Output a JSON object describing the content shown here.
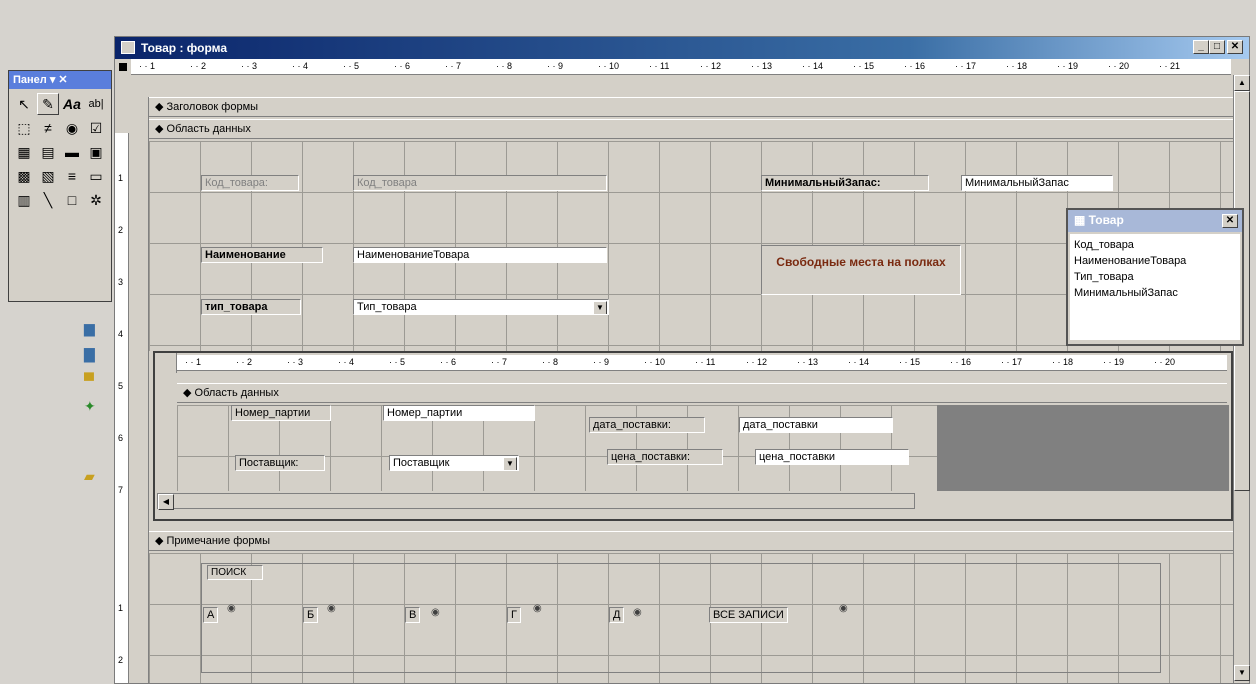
{
  "window": {
    "title": "Товар : форма"
  },
  "toolbox": {
    "title": "Панел ▾ ✕"
  },
  "ruler_numbers": [
    "1",
    "2",
    "3",
    "4",
    "5",
    "6",
    "7",
    "8",
    "9",
    "10",
    "11",
    "12",
    "13",
    "14",
    "15",
    "16",
    "17",
    "18",
    "19",
    "20",
    "21"
  ],
  "sub_ruler_numbers": [
    "1",
    "2",
    "3",
    "4",
    "5",
    "6",
    "7",
    "8",
    "9",
    "10",
    "11",
    "12",
    "13",
    "14",
    "15",
    "16",
    "17",
    "18",
    "19",
    "20"
  ],
  "sections": {
    "header": "Заголовок формы",
    "detail": "Область данных",
    "footer": "Примечание формы",
    "sub_detail": "Область данных"
  },
  "fields": {
    "kod_label": "Код_товара:",
    "kod_value": "Код_товара",
    "min_label": "МинимальныйЗапас:",
    "min_value": "МинимальныйЗапас",
    "name_label": "Наименование",
    "name_value": "НаименованиеТовара",
    "type_label": "тип_товара",
    "type_value": "Тип_товара",
    "free_places": "Свободные места на полках"
  },
  "subform": {
    "partiya_label": "Номер_партии",
    "partiya_value": "Номер_партии",
    "date_label": "дата_поставки:",
    "date_value": "дата_поставки",
    "supplier_label": "Поставщик:",
    "supplier_value": "Поставщик",
    "price_label": "цена_поставки:",
    "price_value": "цена_поставки"
  },
  "footer": {
    "search": "ПОИСК",
    "options": [
      "А",
      "Б",
      "В",
      "Г",
      "Д",
      "ВСЕ ЗАПИСИ"
    ]
  },
  "fieldlist": {
    "title": "Товар",
    "items": [
      "Код_товара",
      "НаименованиеТовара",
      "Тип_товара",
      "МинимальныйЗапас"
    ]
  },
  "colors": {
    "accent": "#0a246a",
    "free_places_text": "#7a2a10"
  }
}
